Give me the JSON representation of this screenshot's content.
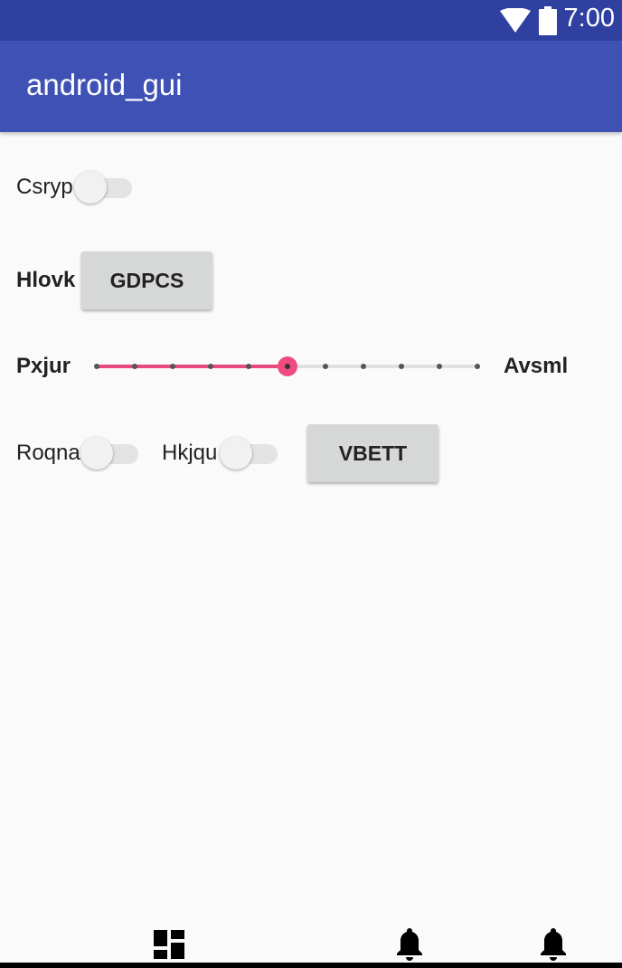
{
  "status_bar": {
    "time": "7:00",
    "wifi_icon": "wifi-icon",
    "battery_icon": "battery-icon"
  },
  "app_bar": {
    "title": "android_gui"
  },
  "row1": {
    "switch_label": "Csryp",
    "switch_on": false
  },
  "row2": {
    "label": "Hlovk",
    "button_label": "GDPCS"
  },
  "row3": {
    "left_label": "Pxjur",
    "right_label": "Avsml",
    "slider_ticks": 10,
    "slider_value": 5
  },
  "row4": {
    "switch1_label": "Roqna",
    "switch1_on": false,
    "switch2_label": "Hkjqu",
    "switch2_on": false,
    "button_label": "VBETT"
  },
  "bottom_bar": {
    "icons": [
      "dashboard-icon",
      "notifications-icon",
      "notifications-icon"
    ]
  },
  "colors": {
    "status_bar": "#3040a0",
    "app_bar": "#3f51b5",
    "accent": "#ef4c80",
    "background": "#fafafa"
  }
}
